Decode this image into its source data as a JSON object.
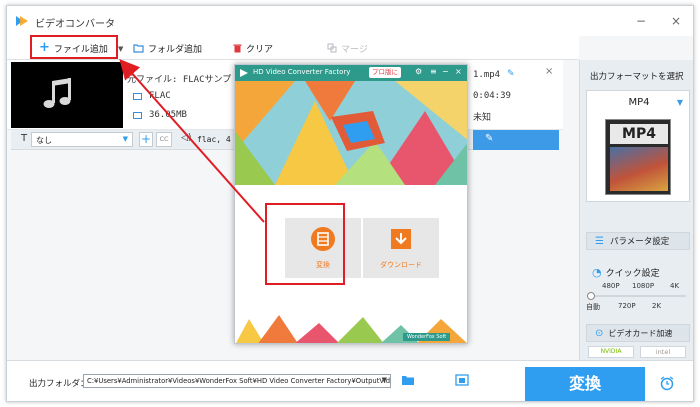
{
  "app": {
    "title": "ビデオコンバータ"
  },
  "window_controls": {
    "minimize": "−",
    "close": "×"
  },
  "toolbar": {
    "add_file_label": "ファイル追加",
    "add_folder_label": "フォルダ追加",
    "clear_label": "クリア",
    "merge_label": "マージ"
  },
  "file_item": {
    "source_name": "元ファイル: FLACサンプ",
    "source_format": "FLAC",
    "source_size": "36.05MB",
    "output_name": "1.mp4",
    "output_duration": "0:04:39",
    "output_size": "未知",
    "subtitle_value": "なし",
    "audio_value": "flac, 4"
  },
  "sidebar": {
    "output_format_label": "出力フォーマットを選択",
    "format_name": "MP4",
    "format_badge": "MP4",
    "params_label": "パラメータ設定",
    "quick_settings_label": "クイック設定",
    "quality_top": [
      "480P",
      "1080P",
      "4K"
    ],
    "quality_bottom": [
      "自動",
      "720P",
      "2K"
    ],
    "gpu_label": "ビデオカード加速",
    "nvidia_label": "NVIDIA",
    "intel_label": "intel"
  },
  "bottom": {
    "output_folder_label": "出力フォルダ：",
    "output_path": "C:¥Users¥Administrator¥Videos¥WonderFox Soft¥HD Video Converter Factory¥OutputVideo¥",
    "convert_label": "変換"
  },
  "popup": {
    "title": "HD Video Converter Factory",
    "pro_label": "プロ版に",
    "convert_tile_label": "変換",
    "download_tile_label": "ダウンロード",
    "footer_label": "WonderFox Soft"
  },
  "colors": {
    "accent": "#2f9ef0",
    "annotation": "#e11d24",
    "popup_title": "#2d9a8c",
    "tile_label": "#f07a20"
  }
}
